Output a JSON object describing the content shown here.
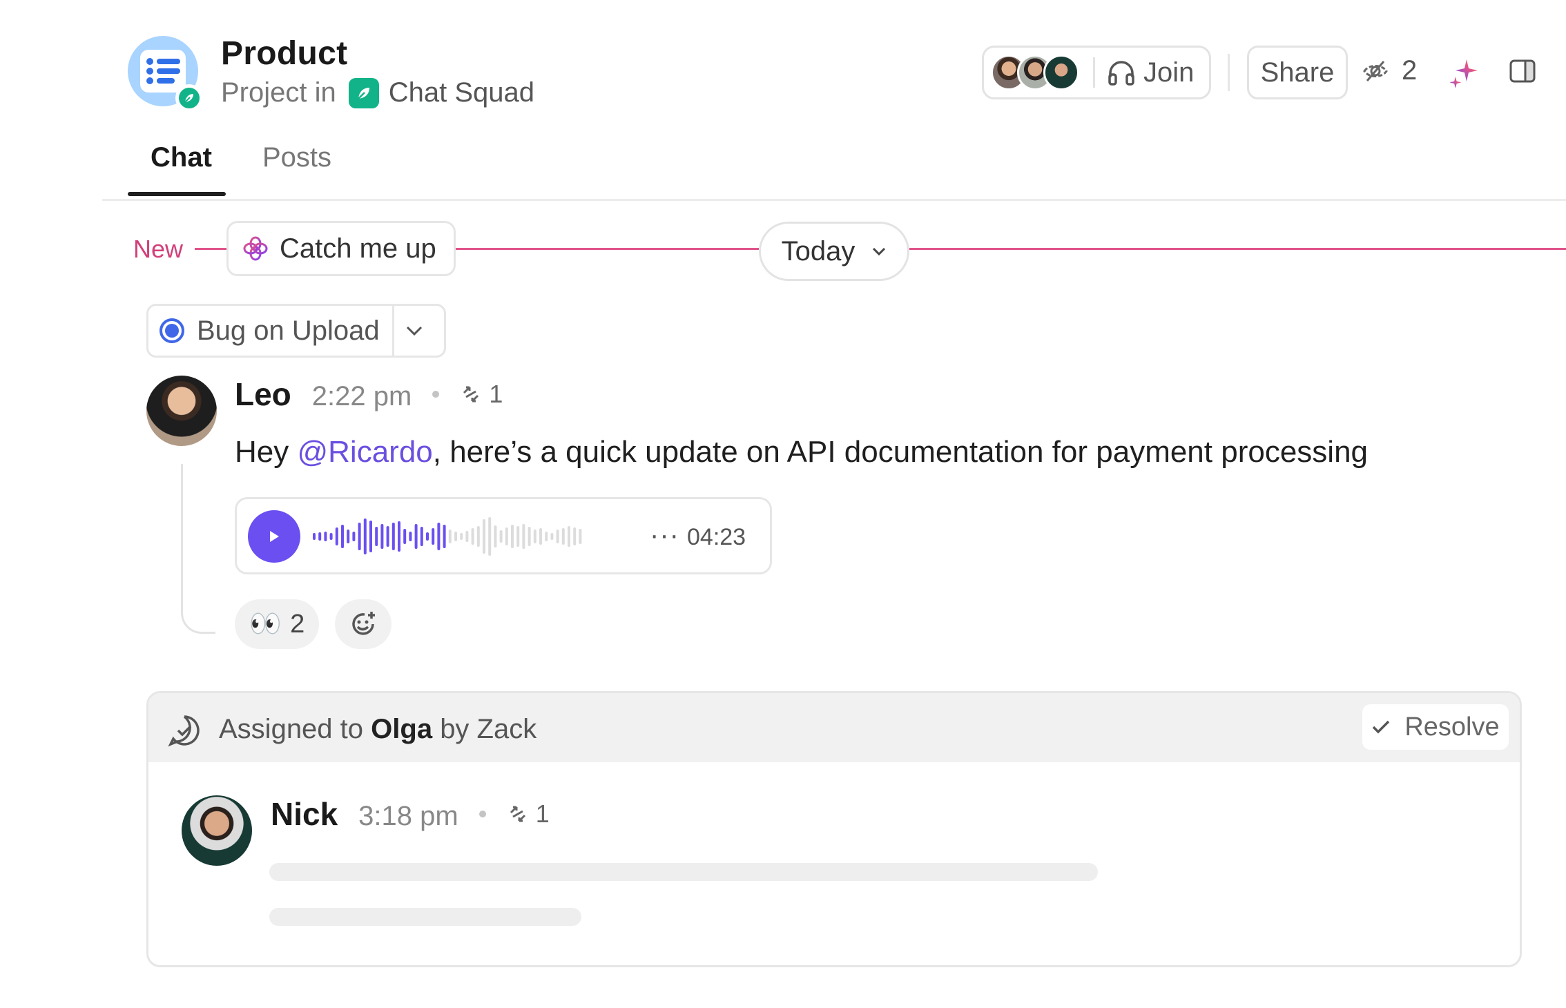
{
  "header": {
    "title": "Product",
    "subtitle_prefix": "Project in",
    "space_name": "Chat Squad",
    "join_label": "Join",
    "share_label": "Share",
    "watchers_count": "2"
  },
  "tabs": [
    {
      "label": "Chat",
      "active": true
    },
    {
      "label": "Posts",
      "active": false
    }
  ],
  "divider": {
    "new_label": "New",
    "catch_up_label": "Catch me up",
    "date_label": "Today"
  },
  "topic": {
    "label": "Bug on Upload"
  },
  "messages": [
    {
      "author": "Leo",
      "time": "2:22 pm",
      "replies": "1",
      "text_prefix": "Hey ",
      "mention": "@Ricardo",
      "text_suffix": ", here’s a quick update on API documentation for payment processing",
      "audio": {
        "duration": "04:23",
        "more_label": "···",
        "progress": 0.5
      },
      "reactions": [
        {
          "emoji": "👀",
          "count": "2"
        }
      ]
    },
    {
      "author": "Nick",
      "time": "3:18 pm",
      "replies": "1"
    }
  ],
  "assignment": {
    "prefix": "Assigned to",
    "assignee": "Olga",
    "by": "by Zack",
    "resolve_label": "Resolve"
  },
  "colors": {
    "accent_purple": "#6b4ff0",
    "new_pink": "#e0538a",
    "space_green": "#12b389",
    "topic_blue": "#3f67e8",
    "project_icon_bg": "#a8d4ff"
  }
}
